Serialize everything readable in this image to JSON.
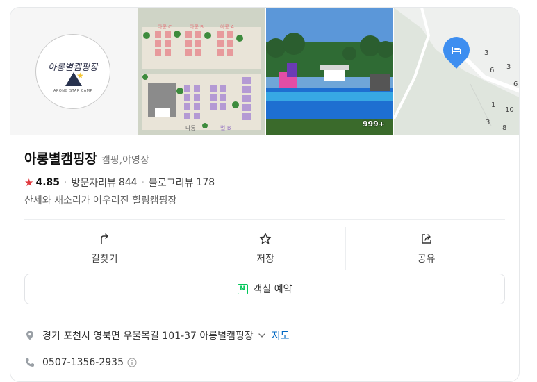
{
  "place": {
    "name": "아롱별캠핑장",
    "category": "캠핑,야영장",
    "rating": "4.85",
    "visitor_review_label": "방문자리뷰",
    "visitor_review_count": "844",
    "blog_review_label": "블로그리뷰",
    "blog_review_count": "178",
    "description": "산세와 새소리가 어우러진 힐링캠핑장"
  },
  "photos": {
    "logo_text": "아롱별캠핑장",
    "logo_sub": "ARONG STAR CAMP",
    "photo_count": "999+",
    "map_numbers": [
      "3",
      "6",
      "3",
      "6",
      "1",
      "10",
      "3",
      "8"
    ],
    "site_labels": [
      "아롱 C",
      "아롱 B",
      "아롱 A",
      "관리동",
      "다롱",
      "별 B"
    ]
  },
  "actions": {
    "directions": "길찾기",
    "save": "저장",
    "share": "공유"
  },
  "reserve": {
    "badge": "N",
    "label": "객실 예약"
  },
  "details": {
    "address": "경기 포천시 영북면 우물목길 101-37 아롱별캠핑장",
    "map_link": "지도",
    "phone": "0507-1356-2935"
  },
  "colors": {
    "star": "#e0393e",
    "link": "#0068c3",
    "naver_green": "#03c75a",
    "pin": "#3d8ef0"
  }
}
